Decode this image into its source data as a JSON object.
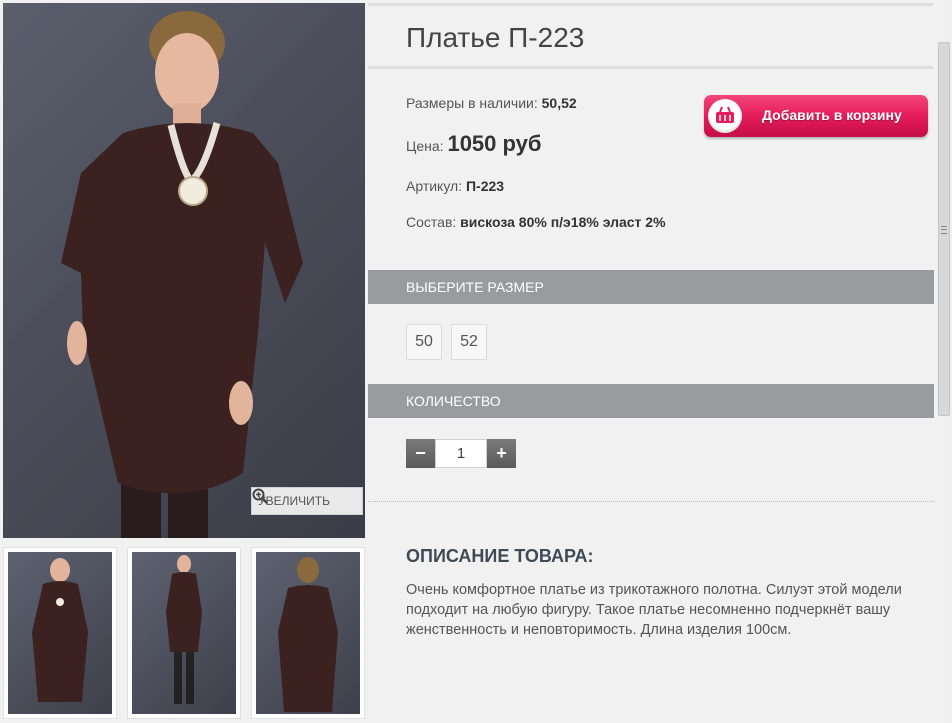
{
  "product": {
    "title": "Платье П-223",
    "sizes_available_label": "Размеры в наличии:",
    "sizes_available_value": "50,52",
    "price_label": "Цена:",
    "price_value": "1050 руб",
    "article_label": "Артикул:",
    "article_value": "П-223",
    "composition_label": "Состав:",
    "composition_value": "вискоза 80% п/э18% эласт 2%"
  },
  "cart_button": {
    "label": "Добавить в корзину",
    "icon": "basket-icon"
  },
  "zoom_button": {
    "label": "УВЕЛИЧИТЬ",
    "icon": "magnifier-plus-icon"
  },
  "size_section": {
    "title": "ВЫБЕРИТЕ РАЗМЕР",
    "options": [
      "50",
      "52"
    ]
  },
  "quantity_section": {
    "title": "КОЛИЧЕСТВО",
    "minus": "−",
    "plus": "+",
    "value": "1"
  },
  "description": {
    "title": "ОПИСАНИЕ ТОВАРА:",
    "text": "Очень комфортное платье из трикотажного полотна. Силуэт этой модели подходит на любую фигуру. Такое платье несомненно подчеркнёт вашу женственность и неповторимость. Длина изделия 100см."
  },
  "colors": {
    "accent_button": "#e41c5b",
    "section_bar": "#999b9e",
    "background": "#f1f1f1",
    "dress": "#3b2220"
  }
}
